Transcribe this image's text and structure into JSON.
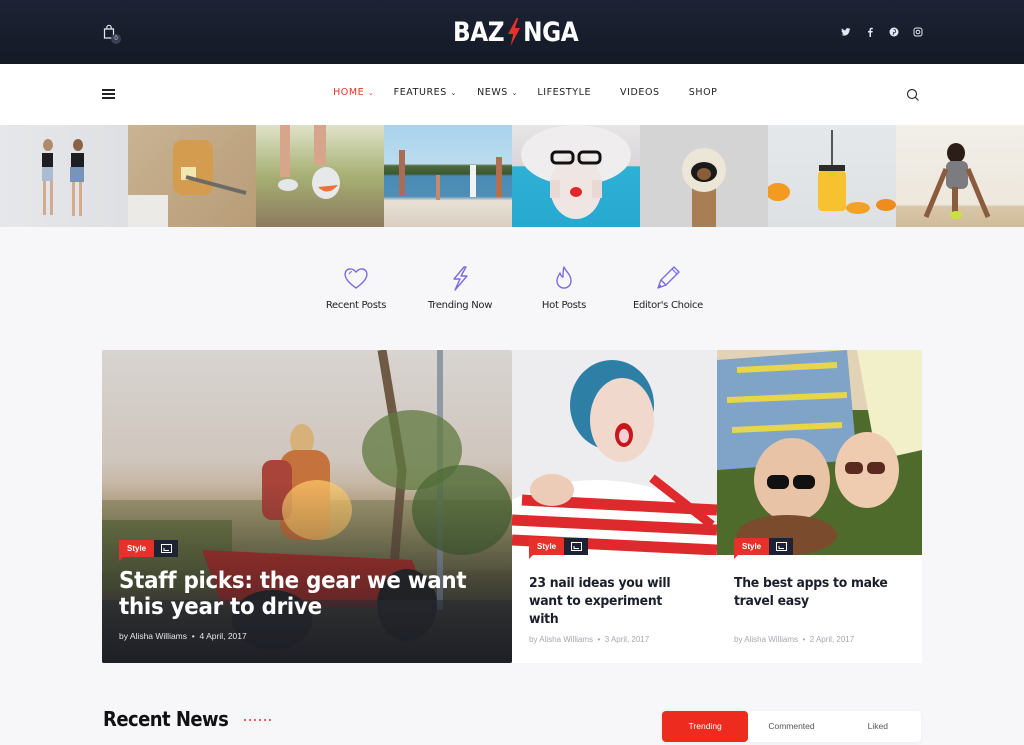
{
  "header": {
    "logo_left": "BAZ",
    "logo_right": "NGA",
    "cart_count": "0",
    "social": [
      "twitter-icon",
      "facebook-icon",
      "pinterest-icon",
      "instagram-icon"
    ]
  },
  "nav": {
    "items": [
      {
        "label": "HOME",
        "dropdown": true,
        "active": true
      },
      {
        "label": "FEATURES",
        "dropdown": true,
        "active": false
      },
      {
        "label": "NEWS",
        "dropdown": true,
        "active": false
      },
      {
        "label": "LIFESTYLE",
        "dropdown": false,
        "active": false
      },
      {
        "label": "VIDEOS",
        "dropdown": false,
        "active": false
      },
      {
        "label": "SHOP",
        "dropdown": false,
        "active": false
      }
    ]
  },
  "strip": {
    "tiles": [
      "two-women-wall",
      "toast-butter-knife",
      "running-shoes",
      "beach-volleyball",
      "white-hair-glasses-woman",
      "dog-in-helmet",
      "orange-juice-jar",
      "sprinter-start"
    ]
  },
  "categories": [
    {
      "label": "Recent Posts",
      "icon": "heart-icon"
    },
    {
      "label": "Trending Now",
      "icon": "lightning-icon"
    },
    {
      "label": "Hot Posts",
      "icon": "flame-icon"
    },
    {
      "label": "Editor's Choice",
      "icon": "pen-icon"
    }
  ],
  "featured": {
    "main": {
      "tag": "Style",
      "title": "Staff picks: the gear we want this year to drive",
      "author": "by Alisha Williams",
      "date": "4 April, 2017"
    },
    "cards": [
      {
        "tag": "Style",
        "title": "23 nail ideas you will want to experiment with",
        "author": "by Alisha Williams",
        "date": "3 April, 2017"
      },
      {
        "tag": "Style",
        "title": "The best apps to make travel easy",
        "author": "by Alisha Williams",
        "date": "2 April, 2017"
      }
    ]
  },
  "recent_news": {
    "title": "Recent News",
    "tabs": [
      {
        "label": "Trending",
        "active": true
      },
      {
        "label": "Commented",
        "active": false
      },
      {
        "label": "Liked",
        "active": false
      }
    ]
  },
  "colors": {
    "accent": "#e8302a",
    "header_bg": "#1a2030",
    "icon_purple": "#7b6be0"
  }
}
